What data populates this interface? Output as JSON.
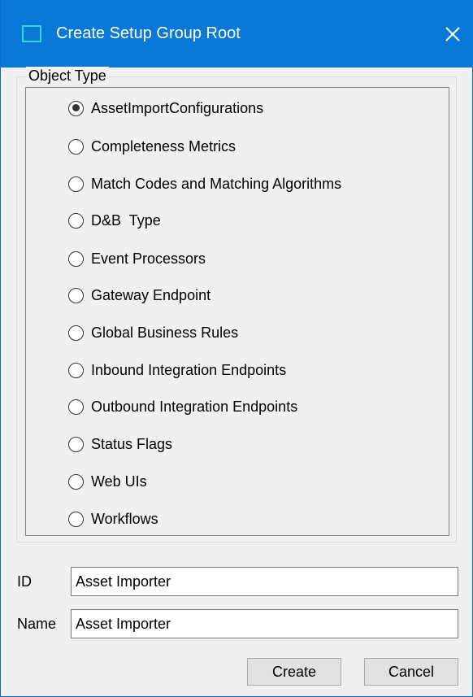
{
  "window": {
    "title": "Create Setup Group Root",
    "close_glyph": "✕"
  },
  "object_type": {
    "legend": "Object Type",
    "selected_index": 0,
    "options": [
      "AssetImportConfigurations",
      "Completeness Metrics",
      "Match Codes and Matching Algorithms",
      "D&B  Type",
      "Event Processors",
      "Gateway Endpoint",
      "Global Business Rules",
      "Inbound Integration Endpoints",
      "Outbound Integration Endpoints",
      "Status Flags",
      "Web UIs",
      "Workflows"
    ]
  },
  "fields": {
    "id_label": "ID",
    "id_value": "Asset Importer",
    "name_label": "Name",
    "name_value": "Asset Importer"
  },
  "buttons": {
    "create_label": "Create",
    "cancel_label": "Cancel"
  },
  "colors": {
    "titlebar": "#0a78d7",
    "window_background": "#f0f0f0"
  }
}
